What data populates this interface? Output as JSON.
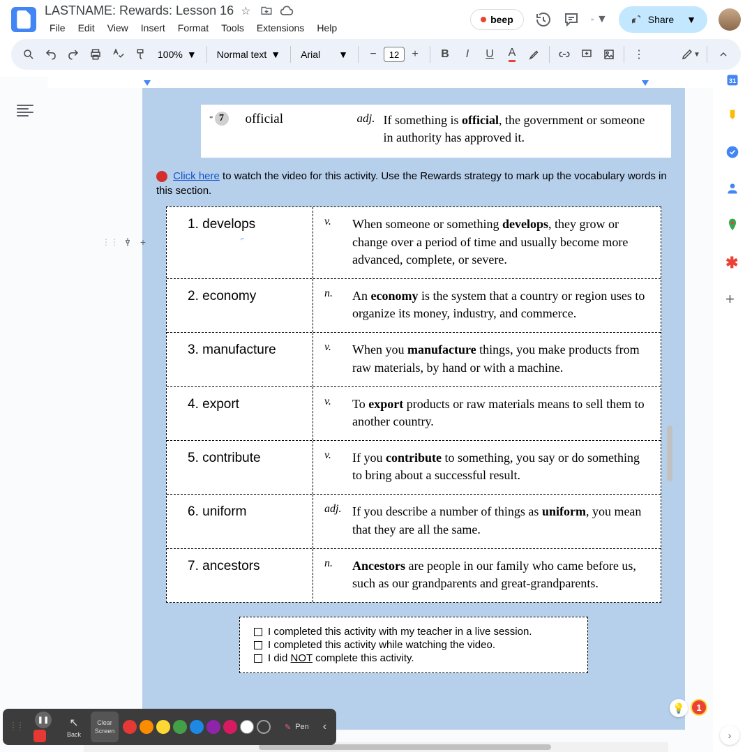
{
  "doc_title": "LASTNAME: Rewards: Lesson 16",
  "menus": [
    "File",
    "Edit",
    "View",
    "Insert",
    "Format",
    "Tools",
    "Extensions",
    "Help"
  ],
  "beep": "beep",
  "share": "Share",
  "toolbar": {
    "zoom": "100%",
    "style": "Normal text",
    "font": "Arial",
    "size": "12"
  },
  "official": {
    "num": "7",
    "word": "official",
    "pos": "adj.",
    "def_pre": "If something is ",
    "def_bold": "official",
    "def_post": ", the government or someone in authority has approved it."
  },
  "instruction": {
    "link": "Click here",
    "text": " to watch the video for this activity. Use the Rewards strategy to mark up the vocabulary words in this section."
  },
  "vocab": [
    {
      "num": "1.",
      "word": "develops",
      "pos": "v.",
      "pre": "When someone or something ",
      "bold": "develops",
      "post": ", they grow or change over a period of time and usually become more advanced, complete, or severe.",
      "cursor": true
    },
    {
      "num": "2.",
      "word": "economy",
      "pos": "n.",
      "pre": "An ",
      "bold": "economy",
      "post": " is the system that a country or region uses to organize its money, industry, and commerce."
    },
    {
      "num": "3.",
      "word": "manufacture",
      "pos": "v.",
      "pre": "When you ",
      "bold": "manufacture",
      "post": " things, you make products from raw materials, by hand or with a machine."
    },
    {
      "num": "4.",
      "word": "export",
      "pos": "v.",
      "pre": "To ",
      "bold": "export",
      "post": " products or raw materials means to sell them to another country."
    },
    {
      "num": "5.",
      "word": "contribute",
      "pos": "v.",
      "pre": "If you ",
      "bold": "contribute",
      "post": " to something, you say or do something to bring about a successful result."
    },
    {
      "num": "6.",
      "word": "uniform",
      "pos": "adj.",
      "pre": "If you describe a number of things as ",
      "bold": "uniform",
      "post": ", you mean that they are all the same."
    },
    {
      "num": "7.",
      "word": "ancestors",
      "pos": "n.",
      "pre": "",
      "bold": "Ancestors",
      "post": " are people in our family who came before us, such as our grandparents and great-grandparents."
    }
  ],
  "checklist": [
    "I completed this activity with my teacher in a live session.",
    "I completed this activity while watching the video.",
    "I did NOT complete this activity."
  ],
  "checklist_not_pre": "I did ",
  "checklist_not_u": "NOT",
  "checklist_not_post": " complete this activity.",
  "annot": {
    "back": "Back",
    "clear1": "Clear",
    "clear2": "Screen",
    "pen": "Pen"
  },
  "badge_count": "1",
  "colors": [
    "#e53935",
    "#fb8c00",
    "#fdd835",
    "#43a047",
    "#1e88e5",
    "#8e24aa",
    "#d81b60",
    "#ffffff",
    "#9e9e9e"
  ]
}
